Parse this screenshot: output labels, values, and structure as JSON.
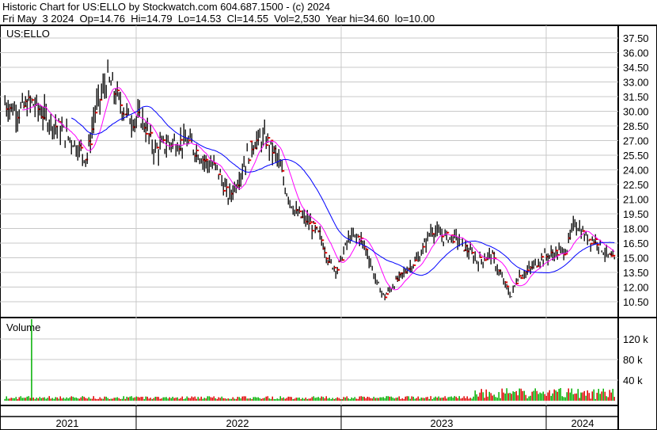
{
  "header": {
    "title": "Historic Chart for US:ELLO by Stockwatch.com 604.687.1500 - (c) 2024",
    "quote": "Fri May  3 2024  Op=14.76  Hi=14.79  Lo=14.53  Cl=14.55  Vol=2,530  Year hi=34.60  lo=10.00"
  },
  "chart_data": {
    "type": "line",
    "symbol_label": "US:ELLO",
    "volume_label": "Volume",
    "ylim": [
      9.5,
      38.5
    ],
    "y_ticks": [
      "37.50",
      "36.00",
      "34.50",
      "33.00",
      "31.50",
      "30.00",
      "28.50",
      "27.00",
      "25.50",
      "24.00",
      "22.50",
      "21.00",
      "19.50",
      "18.00",
      "16.50",
      "15.00",
      "13.50",
      "12.00",
      "10.50"
    ],
    "volume_ticks": [
      {
        "label": "120 k",
        "value": 120000
      },
      {
        "label": "80 k",
        "value": 80000
      },
      {
        "label": "40 k",
        "value": 40000
      }
    ],
    "x_years": [
      "2021",
      "2022",
      "2023",
      "2024"
    ],
    "price_anchors_year_close": [
      [
        2021.36,
        30.8
      ],
      [
        2021.42,
        30.0
      ],
      [
        2021.49,
        30.9
      ],
      [
        2021.57,
        29.2
      ],
      [
        2021.68,
        27.2
      ],
      [
        2021.76,
        25.2
      ],
      [
        2021.8,
        30.0
      ],
      [
        2021.86,
        33.3
      ],
      [
        2021.92,
        30.9
      ],
      [
        2021.97,
        29.2
      ],
      [
        2022.03,
        29.2
      ],
      [
        2022.09,
        26.0
      ],
      [
        2022.17,
        26.8
      ],
      [
        2022.26,
        26.8
      ],
      [
        2022.34,
        24.8
      ],
      [
        2022.4,
        24.0
      ],
      [
        2022.45,
        21.1
      ],
      [
        2022.49,
        22.7
      ],
      [
        2022.57,
        26.8
      ],
      [
        2022.63,
        27.2
      ],
      [
        2022.69,
        25.2
      ],
      [
        2022.73,
        22.0
      ],
      [
        2022.78,
        19.5
      ],
      [
        2022.84,
        18.7
      ],
      [
        2022.9,
        17.1
      ],
      [
        2022.94,
        14.6
      ],
      [
        2022.98,
        13.8
      ],
      [
        2023.04,
        17.1
      ],
      [
        2023.09,
        17.1
      ],
      [
        2023.13,
        15.4
      ],
      [
        2023.17,
        12.6
      ],
      [
        2023.21,
        11.0
      ],
      [
        2023.27,
        12.6
      ],
      [
        2023.32,
        13.8
      ],
      [
        2023.38,
        15.0
      ],
      [
        2023.44,
        17.9
      ],
      [
        2023.5,
        17.1
      ],
      [
        2023.56,
        17.1
      ],
      [
        2023.61,
        15.9
      ],
      [
        2023.67,
        14.6
      ],
      [
        2023.73,
        15.4
      ],
      [
        2023.79,
        12.6
      ],
      [
        2023.83,
        11.0
      ],
      [
        2023.86,
        13.0
      ],
      [
        2023.92,
        13.8
      ],
      [
        2023.98,
        15.0
      ],
      [
        2024.04,
        15.4
      ],
      [
        2024.1,
        15.9
      ],
      [
        2024.14,
        18.7
      ],
      [
        2024.19,
        17.1
      ],
      [
        2024.25,
        16.7
      ],
      [
        2024.29,
        15.4
      ],
      [
        2024.34,
        14.55
      ]
    ],
    "volume_spikes_year_value": [
      [
        2021.49,
        180000
      ],
      [
        2023.8,
        14000
      ],
      [
        2024.17,
        16000
      ]
    ],
    "moving_averages": [
      {
        "name": "short MA",
        "color": "#ff00ff"
      },
      {
        "name": "long MA",
        "color": "#0000ff"
      }
    ],
    "last": {
      "open": 14.76,
      "high": 14.79,
      "low": 14.53,
      "close": 14.55,
      "volume": 2530
    }
  }
}
